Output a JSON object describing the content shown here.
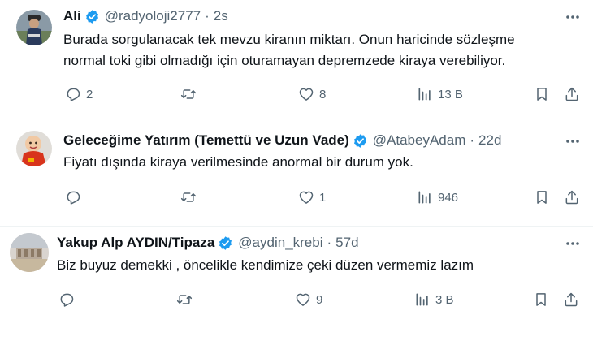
{
  "tweets": [
    {
      "name": "Ali",
      "handle": "@radyoloji2777",
      "time": "2s",
      "body": [
        "Burada sorgulanacak tek mevzu kiranın miktarı. Onun haricinde sözleşme",
        "normal toki gibi olmadığı için oturamayan depremzede kiraya verebiliyor."
      ],
      "replies": "2",
      "retweets": "",
      "likes": "8",
      "views": "13 B"
    },
    {
      "name": "Geleceğime Yatırım (Temettü ve Uzun Vade)",
      "handle": "@AtabeyAdam",
      "time": "22d",
      "body": [
        "Fiyatı dışında kiraya verilmesinde anormal bir durum yok."
      ],
      "replies": "",
      "retweets": "",
      "likes": "1",
      "views": "946"
    },
    {
      "name": "Yakup Alp AYDIN/Tipaza",
      "handle": "@aydin_krebi",
      "time": "57d",
      "body": [
        "Biz buyuz demekki , öncelikle kendimize çeki düzen vermemiz lazım"
      ],
      "replies": "",
      "retweets": "",
      "likes": "9",
      "views": "3 B"
    }
  ],
  "separator": "·",
  "icons": {
    "verified": "verified-badge-icon",
    "more": "more-icon",
    "reply": "reply-icon",
    "retweet": "retweet-icon",
    "like": "like-icon",
    "views": "views-icon",
    "bookmark": "bookmark-icon",
    "share": "share-icon"
  },
  "colors": {
    "verified": "#1d9bf0",
    "secondary_text": "#536471",
    "primary_text": "#0f1419",
    "divider": "#eff3f4"
  }
}
